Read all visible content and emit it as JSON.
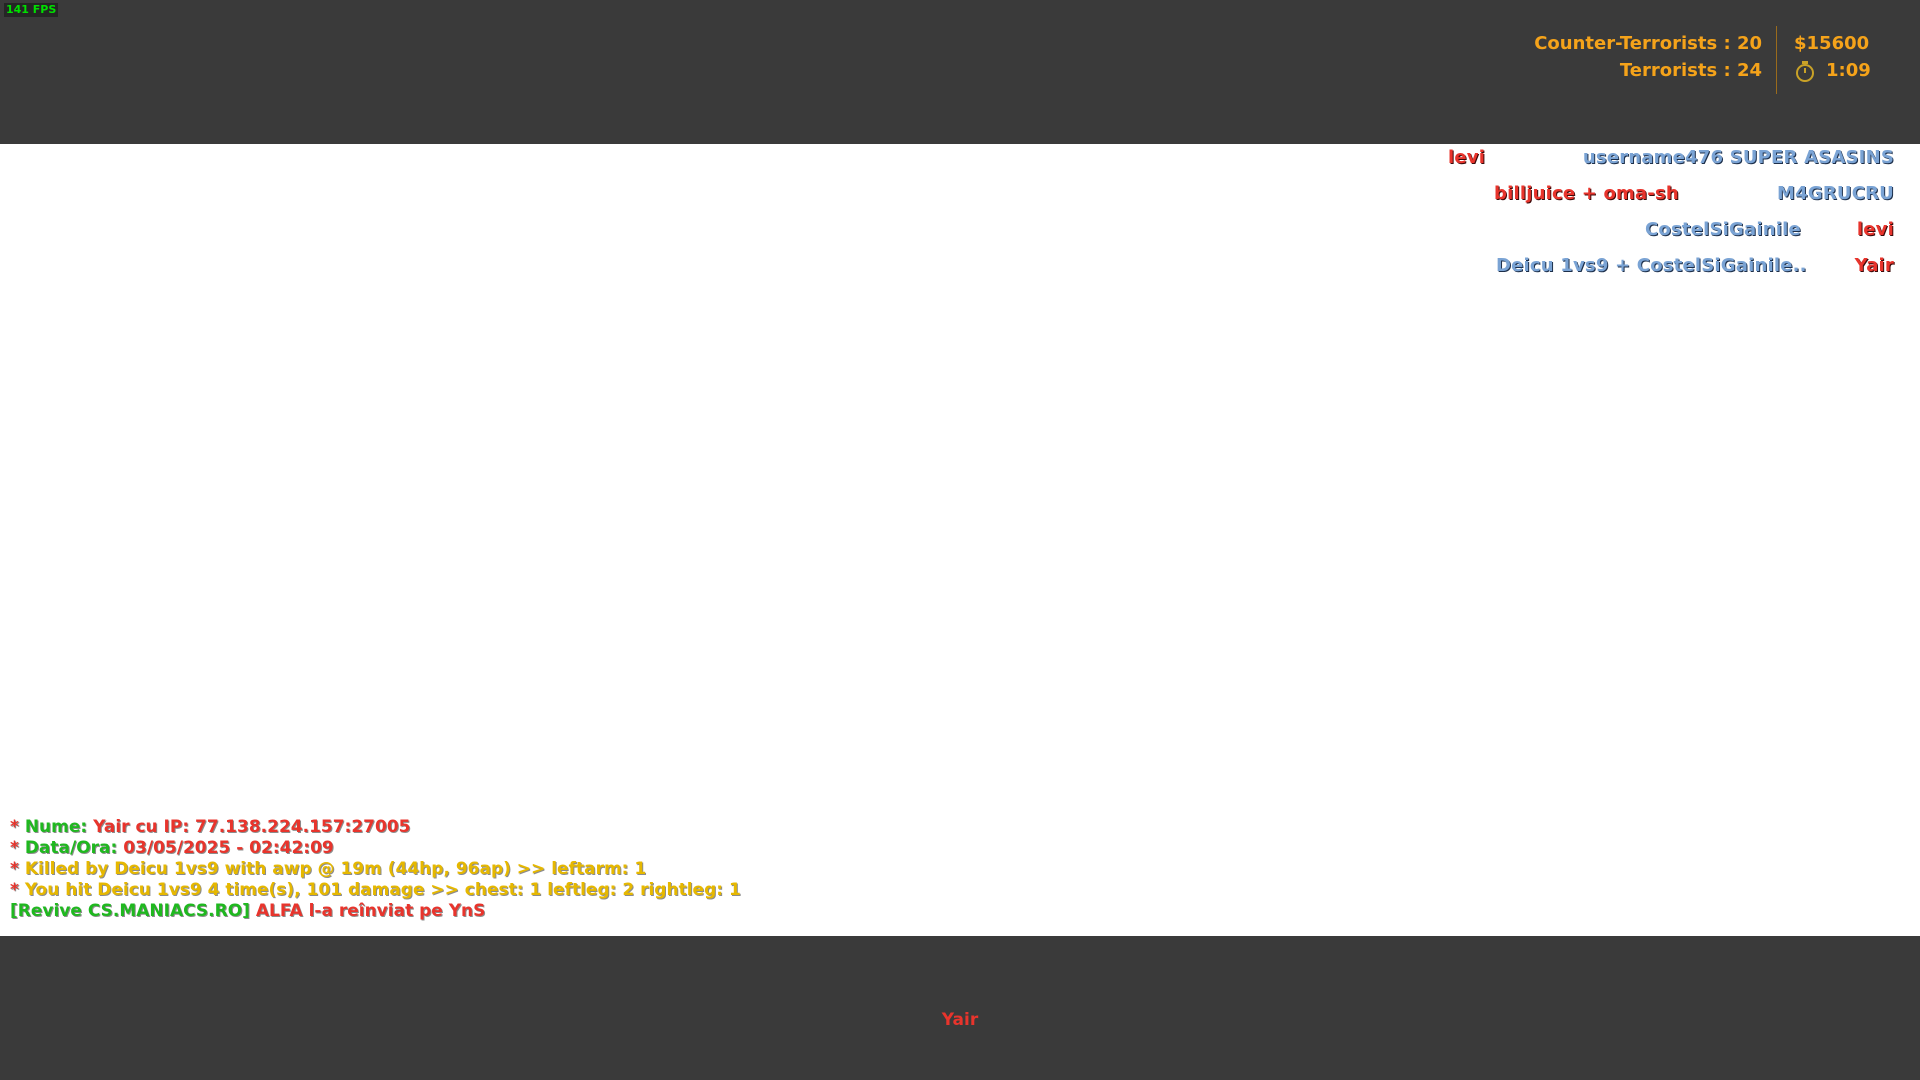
{
  "hud": {
    "fps": "141 FPS",
    "score": {
      "ct_label": "Counter-Terrorists",
      "ct_score": "20",
      "t_label": "Terrorists",
      "t_score": "24"
    },
    "money": "$15600",
    "timer": "1:09",
    "spectated_player": "Yair"
  },
  "killfeed": [
    {
      "killer": "levi",
      "killer_team": "red",
      "victim": "username476 SUPER ASASINS",
      "victim_team": "blue"
    },
    {
      "killer": "billjuice + oma-sh",
      "killer_team": "red",
      "victim": "M4GRUCRU",
      "victim_team": "blue"
    },
    {
      "killer": "CostelSiGainile",
      "killer_team": "blue",
      "victim": "levi",
      "victim_team": "red"
    },
    {
      "killer": "Deicu 1vs9 + CostelSiGainile..",
      "killer_team": "blue",
      "victim": "Yair",
      "victim_team": "red"
    }
  ],
  "chat": {
    "line1": {
      "star": "*",
      "label": "Nume:",
      "value": "Yair cu IP: 77.138.224.157:27005"
    },
    "line2": {
      "star": "*",
      "label": "Data/Ora:",
      "value": "03/05/2025 - 02:42:09"
    },
    "line3": {
      "star": "*",
      "text": "Killed by Deicu 1vs9 with awp @ 19m (44hp, 96ap) >> leftarm: 1"
    },
    "line4": {
      "star": "*",
      "text": "You hit Deicu 1vs9 4 time(s), 101 damage >> chest: 1 leftleg: 2 rightleg: 1"
    },
    "line5": {
      "tag": "[Revive CS.MANIACS.RO]",
      "text": "ALFA l-a reînviat pe YnS"
    }
  },
  "colors": {
    "hud_bar": "#3a3a3a",
    "hud_text": "#f5a31a",
    "terrorist": "#e8342c",
    "counter_terrorist": "#7aa3d4",
    "chat_green": "#1fb81f",
    "chat_yellow": "#e6b800"
  }
}
